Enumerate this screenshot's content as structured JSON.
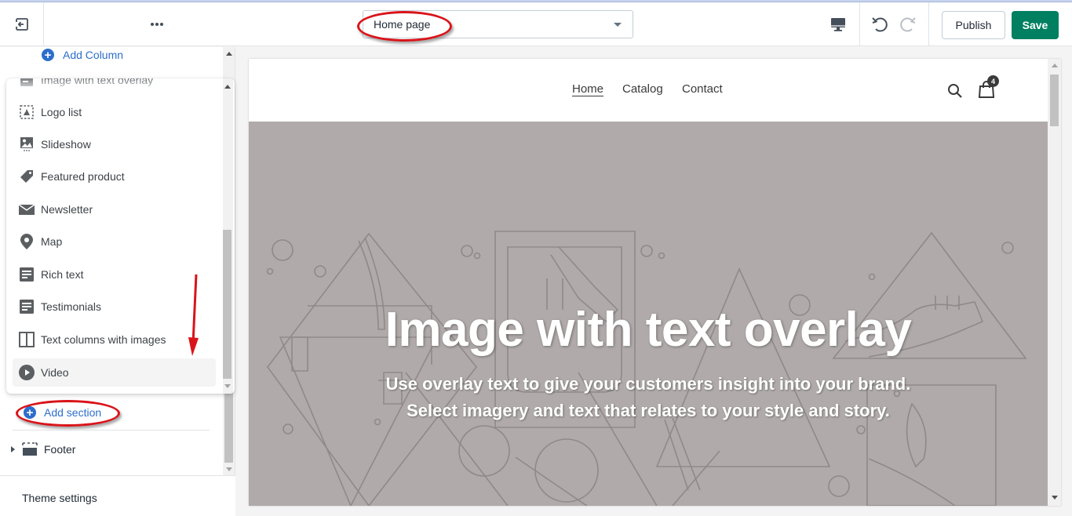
{
  "topbar": {
    "exit_icon": "exit-icon",
    "more_icon": "more-horizontal-icon",
    "page_select": {
      "value": "Home page"
    },
    "device_icon": "desktop-icon",
    "undo_icon": "undo-icon",
    "redo_icon": "redo-icon",
    "publish_label": "Publish",
    "save_label": "Save",
    "colors": {
      "save_bg": "#008060",
      "link": "#2c6ecb"
    }
  },
  "sidebar": {
    "add_column_label": "Add Column",
    "section_picker": {
      "items": [
        {
          "label": "Image with text overlay",
          "icon": "image-text-overlay-icon"
        },
        {
          "label": "Logo list",
          "icon": "logo-list-icon"
        },
        {
          "label": "Slideshow",
          "icon": "slideshow-icon"
        },
        {
          "label": "Featured product",
          "icon": "tag-icon"
        },
        {
          "label": "Newsletter",
          "icon": "envelope-icon"
        },
        {
          "label": "Map",
          "icon": "map-pin-icon"
        },
        {
          "label": "Rich text",
          "icon": "rich-text-icon"
        },
        {
          "label": "Testimonials",
          "icon": "testimonials-icon"
        },
        {
          "label": "Text columns with images",
          "icon": "columns-icon"
        },
        {
          "label": "Video",
          "icon": "play-circle-icon",
          "hovered": true
        }
      ]
    },
    "add_section_label": "Add section",
    "footer_label": "Footer",
    "theme_settings_label": "Theme settings"
  },
  "preview": {
    "nav": [
      {
        "label": "Home",
        "active": true
      },
      {
        "label": "Catalog",
        "active": false
      },
      {
        "label": "Contact",
        "active": false
      }
    ],
    "cart_count": "4",
    "hero": {
      "title": "Image with text overlay",
      "subtitle": "Use overlay text to give your customers insight into your brand. Select imagery and text that relates to your style and story.",
      "bg_color": "#b0aaaa"
    }
  },
  "annotations": {
    "highlight_color": "#d9141a"
  }
}
